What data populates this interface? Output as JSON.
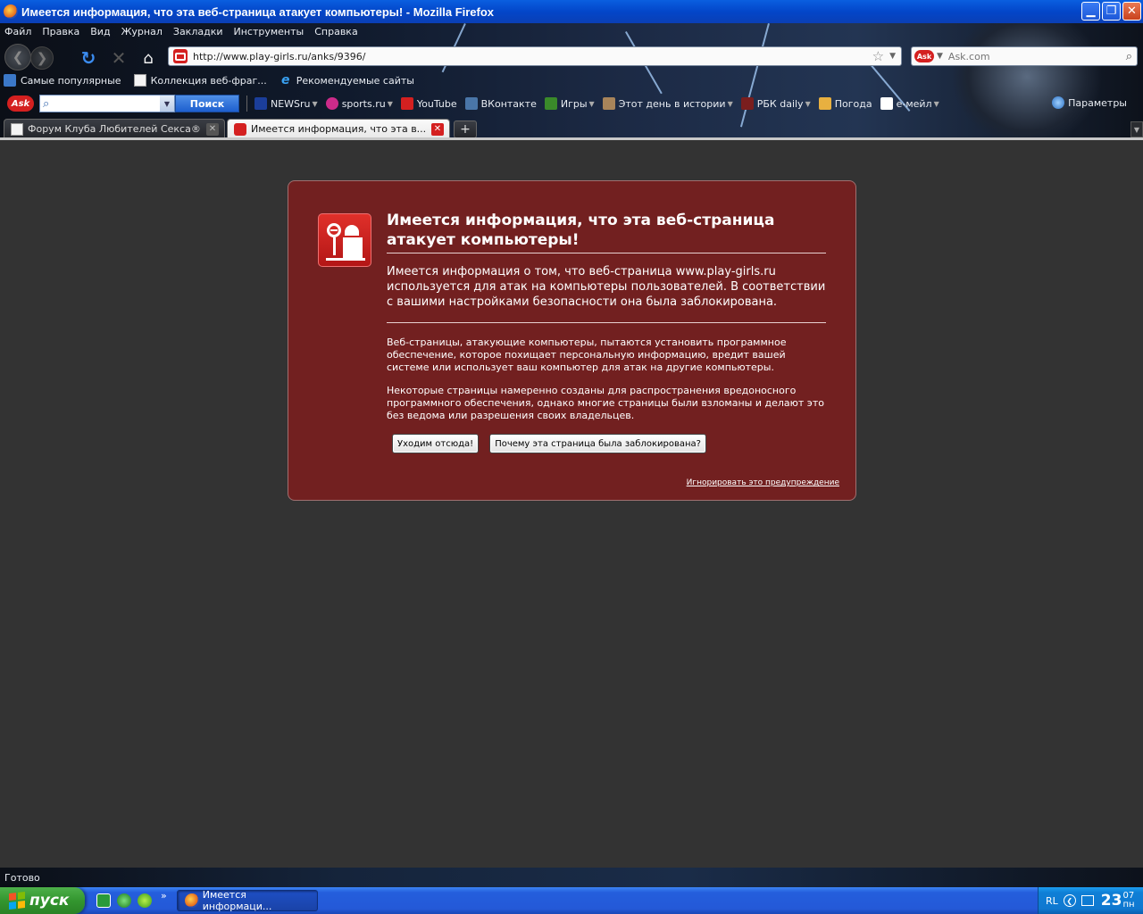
{
  "window": {
    "title": "Имеется информация, что эта веб-страница атакует компьютеры! - Mozilla Firefox",
    "min_glyph": "▁",
    "max_glyph": "❐",
    "close_glyph": "✕"
  },
  "menu": [
    "Файл",
    "Правка",
    "Вид",
    "Журнал",
    "Закладки",
    "Инструменты",
    "Справка"
  ],
  "nav": {
    "url": "http://www.play-girls.ru/anks/9396/",
    "search_placeholder": "Ask.com",
    "ask_badge": "Ask"
  },
  "bookmarks": [
    "Самые популярные",
    "Коллекция веб-фраг...",
    "Рекомендуемые сайты"
  ],
  "ask_toolbar": {
    "logo": "Ask",
    "search_button": "Поиск",
    "items": [
      {
        "label": "NEWSru",
        "color": "#1b3e9a"
      },
      {
        "label": "sports.ru",
        "color": "#cc2b8a"
      },
      {
        "label": "YouTube",
        "color": "#d42020"
      },
      {
        "label": "ВКонтакте",
        "color": "#4a76a8"
      },
      {
        "label": "Игры",
        "color": "#3a8a2a"
      },
      {
        "label": "Этот день в истории",
        "color": "#a8845a"
      },
      {
        "label": "РБК daily",
        "color": "#7a1e1e"
      },
      {
        "label": "Погода",
        "color": "#e8b040"
      },
      {
        "label": "e-мейл",
        "color": "#ffffff"
      }
    ],
    "params_label": "Параметры"
  },
  "tabs": [
    {
      "label": "Форум Клуба Любителей Секса®: б...",
      "active": false
    },
    {
      "label": "Имеется информация, что эта в...",
      "active": true
    }
  ],
  "error": {
    "title": "Имеется информация, что эта веб-страница атакует компьютеры!",
    "short_desc": "Имеется информация о том, что веб-страница www.play-girls.ru используется для атак на компьютеры пользователей. В соответствии с вашими настройками безопасности она была заблокирована.",
    "long_desc_1": "Веб-страницы, атакующие компьютеры, пытаются установить программное обеспечение, которое похищает персональную информацию, вредит вашей системе или использует ваш компьютер для атак на другие компьютеры.",
    "long_desc_2": "Некоторые страницы намеренно созданы для распространения вредоносного программного обеспечения, однако многие страницы были взломаны и делают это без ведома или разрешения своих владельцев.",
    "get_me_out": "Уходим отсюда!",
    "why_blocked": "Почему эта страница была заблокирована?",
    "ignore": "Игнорировать это предупреждение"
  },
  "status": {
    "text": "Готово"
  },
  "taskbar": {
    "start": "пуск",
    "task": "Имеется информаци...",
    "quicklaunch_chevron": "»",
    "lang": "RL",
    "tray_arrow": "❮",
    "clock_hour": "23",
    "clock_min": "07",
    "clock_day": "пн"
  },
  "colors": {
    "error_bg": "#722020",
    "content_bg": "#333333",
    "xp_blue": "#245edc",
    "start_green": "#33962f"
  }
}
